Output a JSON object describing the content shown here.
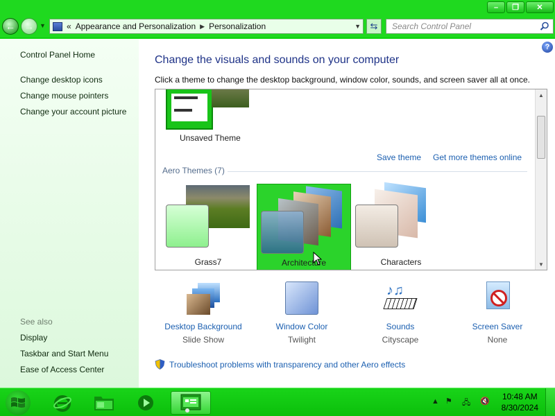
{
  "window": {
    "minimize_icon": "minimize-icon",
    "maximize_icon": "maximize-icon",
    "close_icon": "close-icon"
  },
  "nav": {
    "breadcrumb_lead": "«",
    "breadcrumb": [
      "Appearance and Personalization",
      "Personalization"
    ],
    "search_placeholder": "Search Control Panel"
  },
  "sidebar": {
    "home": "Control Panel Home",
    "links": [
      "Change desktop icons",
      "Change mouse pointers",
      "Change your account picture"
    ],
    "see_also_label": "See also",
    "see_also": [
      "Display",
      "Taskbar and Start Menu",
      "Ease of Access Center"
    ]
  },
  "main": {
    "title": "Change the visuals and sounds on your computer",
    "subtitle": "Click a theme to change the desktop background, window color, sounds, and screen saver all at once.",
    "unsaved_theme": "Unsaved Theme",
    "save_theme": "Save theme",
    "more_themes": "Get more themes online",
    "aero_group": "Aero Themes (7)",
    "themes": [
      {
        "name": "Grass7",
        "selected": false
      },
      {
        "name": "Architecture",
        "selected": true
      },
      {
        "name": "Characters",
        "selected": false
      }
    ],
    "options": [
      {
        "label": "Desktop Background",
        "value": "Slide Show",
        "icon": "desktop-background-icon"
      },
      {
        "label": "Window Color",
        "value": "Twilight",
        "icon": "window-color-icon"
      },
      {
        "label": "Sounds",
        "value": "Cityscape",
        "icon": "sounds-icon"
      },
      {
        "label": "Screen Saver",
        "value": "None",
        "icon": "screen-saver-icon"
      }
    ],
    "troubleshoot": "Troubleshoot problems with transparency and other Aero effects"
  },
  "taskbar": {
    "time": "10:48 AM",
    "date": "8/30/2024"
  },
  "colors": {
    "accent_green": "#1fd91f",
    "link_blue": "#1b5fb0",
    "title_blue": "#1e3287"
  }
}
